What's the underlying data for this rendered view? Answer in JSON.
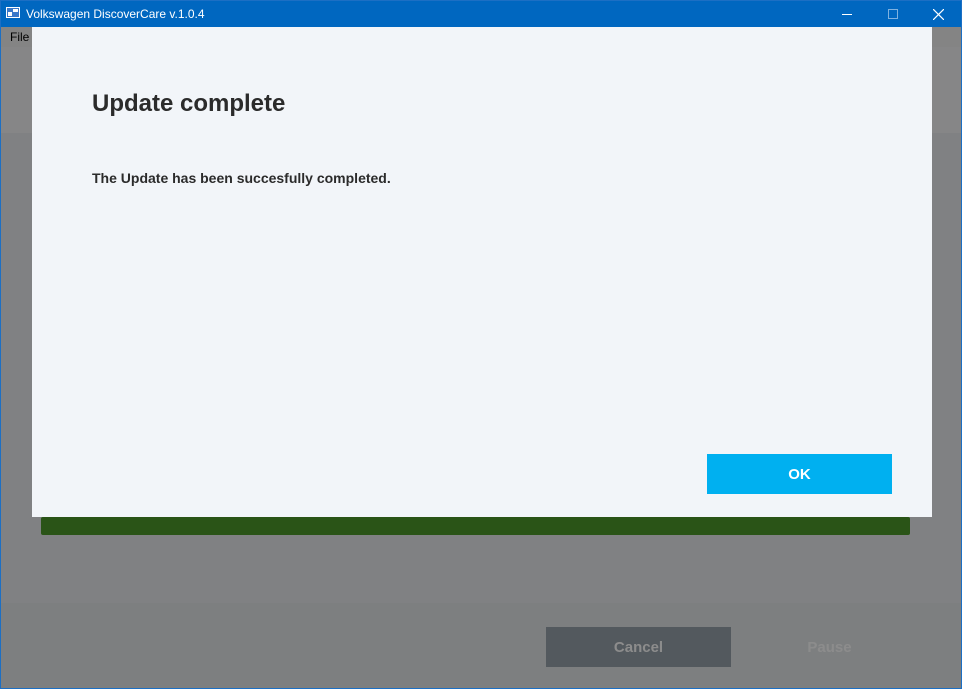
{
  "window": {
    "title": "Volkswagen DiscoverCare v.1.0.4"
  },
  "menu": {
    "file_label": "File"
  },
  "footer": {
    "cancel_label": "Cancel",
    "pause_label": "Pause"
  },
  "dialog": {
    "title": "Update complete",
    "message": "The Update has been succesfully completed.",
    "ok_label": "OK"
  },
  "progress": {
    "fraction": 1.0
  },
  "icons": {
    "app": "app-icon",
    "minimize": "minimize-icon",
    "maximize": "maximize-icon",
    "close": "close-icon"
  },
  "colors": {
    "titlebar": "#0067c0",
    "progress": "#4e9a2b",
    "ok_button": "#00b0f0",
    "cancel_button": "#98a3ac",
    "dialog_bg": "#f2f5f9"
  }
}
